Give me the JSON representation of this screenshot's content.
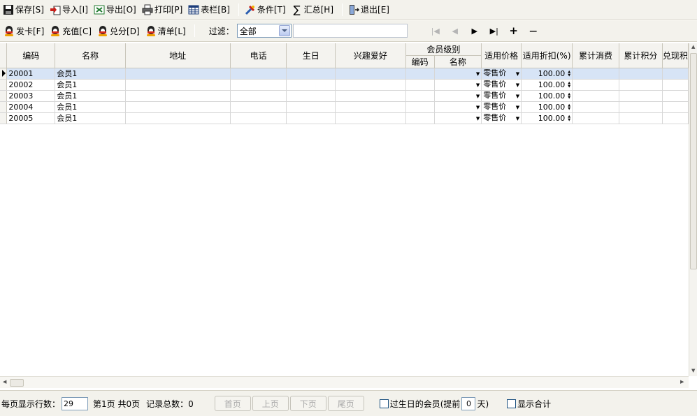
{
  "toolbar": {
    "save": "保存[S]",
    "import": "导入[I]",
    "export": "导出[O]",
    "print": "打印[P]",
    "columns": "表栏[B]",
    "conditions": "条件[T]",
    "summary": "汇总[H]",
    "exit": "退出[E]"
  },
  "toolbar2": {
    "issue_card": "发卡[F]",
    "recharge": "充值[C]",
    "redeem": "兑分[D]",
    "list": "清单[L]",
    "filter_label": "过滤：",
    "filter_value": "全部",
    "filter_text": "",
    "nav": {
      "first": "|◀",
      "prev": "◀",
      "next": "▶",
      "last": "▶|",
      "add": "+",
      "remove": "—"
    }
  },
  "grid": {
    "headers": {
      "code": "编码",
      "name": "名称",
      "address": "地址",
      "phone": "电话",
      "birthday": "生日",
      "hobby": "兴趣爱好",
      "level_group": "会员级别",
      "level_code": "编码",
      "level_name": "名称",
      "price": "适用价格",
      "discount": "适用折扣(%)",
      "total_spent": "累计消费",
      "total_points": "累计积分",
      "redeemed": "兑现积"
    },
    "rows": [
      {
        "code": "20001",
        "name": "会员1",
        "address": "",
        "phone": "",
        "birthday": "",
        "hobby": "",
        "level_code": "",
        "level_name": "",
        "price": "零售价",
        "discount": "100.00",
        "total_spent": "",
        "total_points": "",
        "redeemed": "",
        "selected": true
      },
      {
        "code": "20002",
        "name": "会员1",
        "address": "",
        "phone": "",
        "birthday": "",
        "hobby": "",
        "level_code": "",
        "level_name": "",
        "price": "零售价",
        "discount": "100.00",
        "total_spent": "",
        "total_points": "",
        "redeemed": "",
        "selected": false
      },
      {
        "code": "20003",
        "name": "会员1",
        "address": "",
        "phone": "",
        "birthday": "",
        "hobby": "",
        "level_code": "",
        "level_name": "",
        "price": "零售价",
        "discount": "100.00",
        "total_spent": "",
        "total_points": "",
        "redeemed": "",
        "selected": false
      },
      {
        "code": "20004",
        "name": "会员1",
        "address": "",
        "phone": "",
        "birthday": "",
        "hobby": "",
        "level_code": "",
        "level_name": "",
        "price": "零售价",
        "discount": "100.00",
        "total_spent": "",
        "total_points": "",
        "redeemed": "",
        "selected": false
      },
      {
        "code": "20005",
        "name": "会员1",
        "address": "",
        "phone": "",
        "birthday": "",
        "hobby": "",
        "level_code": "",
        "level_name": "",
        "price": "零售价",
        "discount": "100.00",
        "total_spent": "",
        "total_points": "",
        "redeemed": "",
        "selected": false
      }
    ]
  },
  "footer": {
    "rows_per_page_label": "每页显示行数：",
    "rows_per_page": "29",
    "page_info": "第1页  共0页",
    "record_count": "记录总数：0",
    "first_page": "首页",
    "prev_page": "上页",
    "next_page": "下页",
    "last_page": "尾页",
    "birthday_label": "过生日的会员(提前",
    "birthday_days": "0",
    "days_label": "天)",
    "show_total": "显示合计"
  },
  "icons": {
    "save": "floppy-disk-icon",
    "import": "import-icon",
    "export": "excel-export-icon",
    "print": "printer-icon",
    "columns": "table-icon",
    "conditions": "tools-icon",
    "summary": "sigma-icon",
    "exit": "exit-door-icon",
    "member": "penguin-icon"
  }
}
